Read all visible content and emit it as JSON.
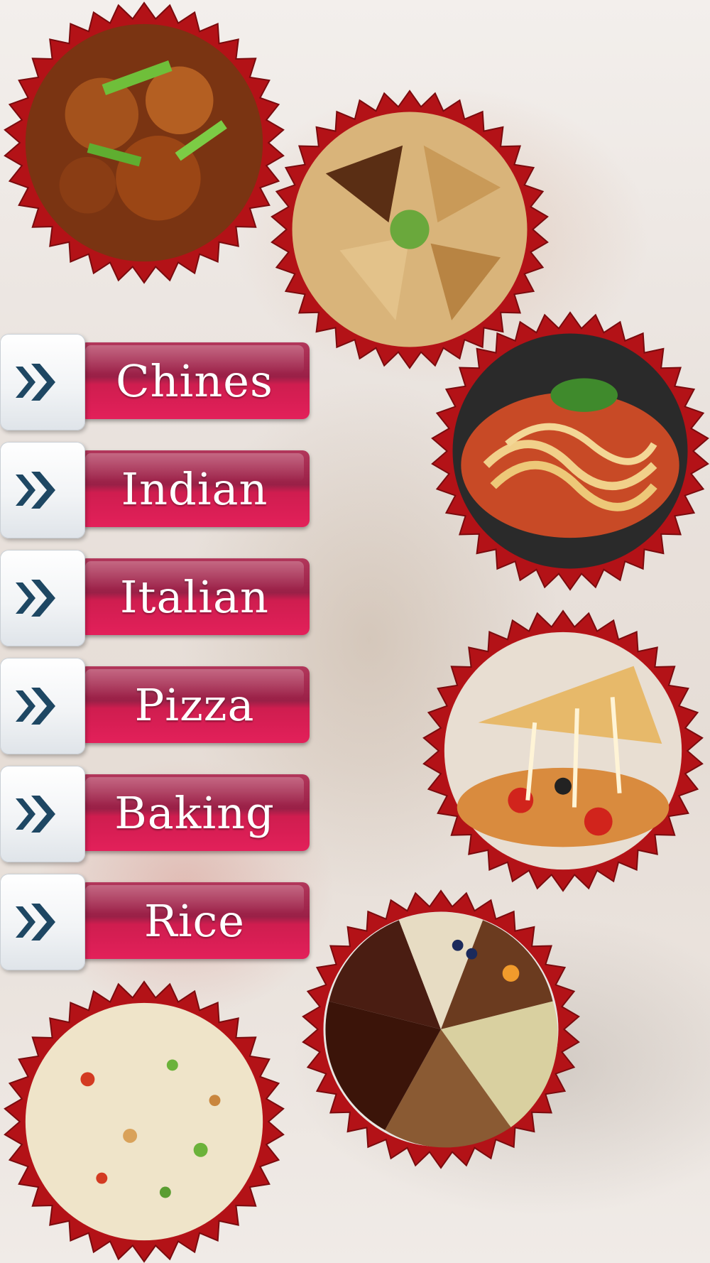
{
  "menu": {
    "items": [
      {
        "label": "Chines"
      },
      {
        "label": "Indian"
      },
      {
        "label": "Italian"
      },
      {
        "label": "Pizza"
      },
      {
        "label": "Baking"
      },
      {
        "label": "Rice"
      }
    ]
  },
  "icons": {
    "menu_arrow": "double-chevron-right-icon"
  },
  "images": [
    {
      "name": "chinese-dish-image"
    },
    {
      "name": "indian-snacks-image"
    },
    {
      "name": "pasta-image"
    },
    {
      "name": "pizza-image"
    },
    {
      "name": "cake-image"
    },
    {
      "name": "fried-rice-image"
    }
  ],
  "colors": {
    "button_red": "#c41f4f",
    "badge_border": "#b31217",
    "arrow": "#1e4763"
  }
}
